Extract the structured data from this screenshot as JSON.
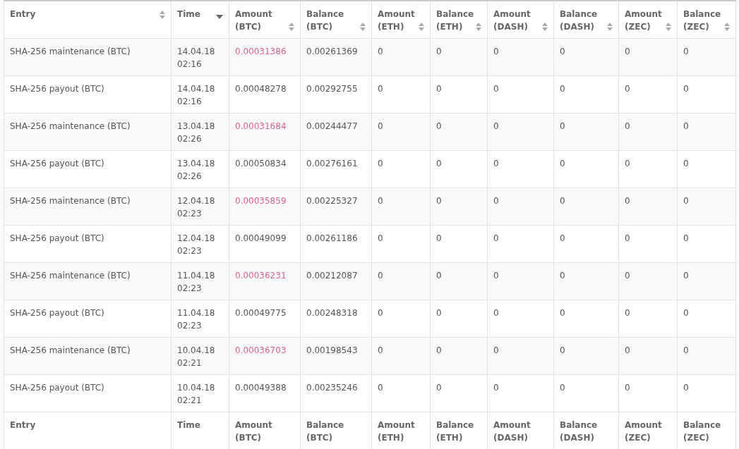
{
  "table": {
    "columns": [
      {
        "label": "Entry",
        "sorted": false
      },
      {
        "label": "Time",
        "sorted": true
      },
      {
        "label": "Amount (BTC)",
        "sorted": false
      },
      {
        "label": "Balance (BTC)",
        "sorted": false
      },
      {
        "label": "Amount (ETH)",
        "sorted": false
      },
      {
        "label": "Balance (ETH)",
        "sorted": false
      },
      {
        "label": "Amount (DASH)",
        "sorted": false
      },
      {
        "label": "Balance (DASH)",
        "sorted": false
      },
      {
        "label": "Amount (ZEC)",
        "sorted": false
      },
      {
        "label": "Balance (ZEC)",
        "sorted": false
      }
    ],
    "rows": [
      {
        "kind": "maintenance",
        "cells": [
          "SHA-256 maintenance (BTC)",
          "14.04.18 02:16",
          "0.00031386",
          "0.00261369",
          "0",
          "0",
          "0",
          "0",
          "0",
          "0"
        ]
      },
      {
        "kind": "payout",
        "cells": [
          "SHA-256 payout (BTC)",
          "14.04.18 02:16",
          "0.00048278",
          "0.00292755",
          "0",
          "0",
          "0",
          "0",
          "0",
          "0"
        ]
      },
      {
        "kind": "maintenance",
        "cells": [
          "SHA-256 maintenance (BTC)",
          "13.04.18 02:26",
          "0.00031684",
          "0.00244477",
          "0",
          "0",
          "0",
          "0",
          "0",
          "0"
        ]
      },
      {
        "kind": "payout",
        "cells": [
          "SHA-256 payout (BTC)",
          "13.04.18 02:26",
          "0.00050834",
          "0.00276161",
          "0",
          "0",
          "0",
          "0",
          "0",
          "0"
        ]
      },
      {
        "kind": "maintenance",
        "cells": [
          "SHA-256 maintenance (BTC)",
          "12.04.18 02:23",
          "0.00035859",
          "0.00225327",
          "0",
          "0",
          "0",
          "0",
          "0",
          "0"
        ]
      },
      {
        "kind": "payout",
        "cells": [
          "SHA-256 payout (BTC)",
          "12.04.18 02:23",
          "0.00049099",
          "0.00261186",
          "0",
          "0",
          "0",
          "0",
          "0",
          "0"
        ]
      },
      {
        "kind": "maintenance",
        "cells": [
          "SHA-256 maintenance (BTC)",
          "11.04.18 02:23",
          "0.00036231",
          "0.00212087",
          "0",
          "0",
          "0",
          "0",
          "0",
          "0"
        ]
      },
      {
        "kind": "payout",
        "cells": [
          "SHA-256 payout (BTC)",
          "11.04.18 02:23",
          "0.00049775",
          "0.00248318",
          "0",
          "0",
          "0",
          "0",
          "0",
          "0"
        ]
      },
      {
        "kind": "maintenance",
        "cells": [
          "SHA-256 maintenance (BTC)",
          "10.04.18 02:21",
          "0.00036703",
          "0.00198543",
          "0",
          "0",
          "0",
          "0",
          "0",
          "0"
        ]
      },
      {
        "kind": "payout",
        "cells": [
          "SHA-256 payout (BTC)",
          "10.04.18 02:21",
          "0.00049388",
          "0.00235246",
          "0",
          "0",
          "0",
          "0",
          "0",
          "0"
        ]
      }
    ],
    "footer": [
      "Entry",
      "Time",
      "Amount (BTC)",
      "Balance (BTC)",
      "Amount (ETH)",
      "Balance (ETH)",
      "Amount (DASH)",
      "Balance (DASH)",
      "Amount (ZEC)",
      "Balance (ZEC)"
    ]
  }
}
